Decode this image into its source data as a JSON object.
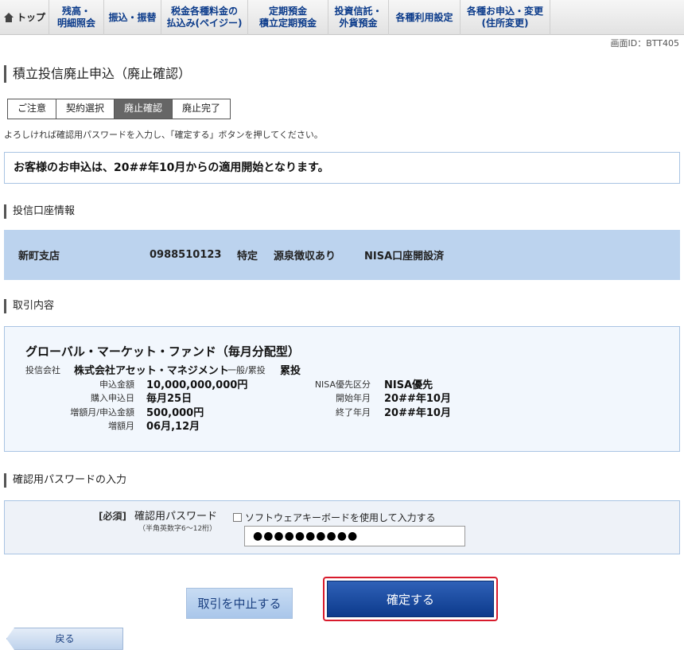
{
  "nav": {
    "items": [
      {
        "label": "トップ",
        "icon": "home-icon"
      },
      {
        "label": "残高・\n明細照会"
      },
      {
        "label": "振込・振替"
      },
      {
        "label": "税金各種料金の\n払込み(ペイジー)"
      },
      {
        "label": "定期預金\n積立定期預金"
      },
      {
        "label": "投資信託・\n外貨預金"
      },
      {
        "label": "各種利用設定"
      },
      {
        "label": "各種お申込・変更\n(住所変更)"
      }
    ]
  },
  "screen_id": "画面ID：BTT405",
  "page_title": "積立投信廃止申込（廃止確認）",
  "steps": [
    "ご注意",
    "契約選択",
    "廃止確認",
    "廃止完了"
  ],
  "active_step": 2,
  "instruction": "よろしければ確認用パスワードを入力し、「確定する」ボタンを押してください。",
  "notice": "お客様のお申込は、20##年10月からの適用開始となります。",
  "account_section": {
    "heading": "投信口座情報",
    "branch": "新町支店",
    "account_no": "0988510123",
    "type": "特定",
    "withholding": "源泉徴収あり",
    "nisa": "NISA口座開設済"
  },
  "trade_section": {
    "heading": "取引内容",
    "fund_name": "グローバル・マーケット・ファンド（毎月分配型）",
    "company_label": "投信会社",
    "company": "株式会社アセット・マネジメント",
    "category_label": "一般/累投",
    "category": "累投",
    "amount_label": "申込金額",
    "amount": "10,000,000,000円",
    "purchase_day_label": "購入申込日",
    "purchase_day": "毎月25日",
    "bonus_amount_label": "増額月/申込金額",
    "bonus_amount": "500,000円",
    "bonus_month_label": "増額月",
    "bonus_month": "06月,12月",
    "nisa_label": "NISA優先区分",
    "nisa_value": "NISA優先",
    "start_label": "開始年月",
    "start_value": "20##年10月",
    "end_label": "終了年月",
    "end_value": "20##年10月"
  },
  "password_section": {
    "heading": "確認用パスワードの入力",
    "required": "[必須]",
    "label": "確認用パスワード",
    "hint": "（半角英数字6～12桁）",
    "keyboard_option": "ソフトウェアキーボードを使用して入力する",
    "value": "●●●●●●●●●●"
  },
  "buttons": {
    "cancel": "取引を中止する",
    "confirm": "確定する",
    "back": "戻る"
  }
}
